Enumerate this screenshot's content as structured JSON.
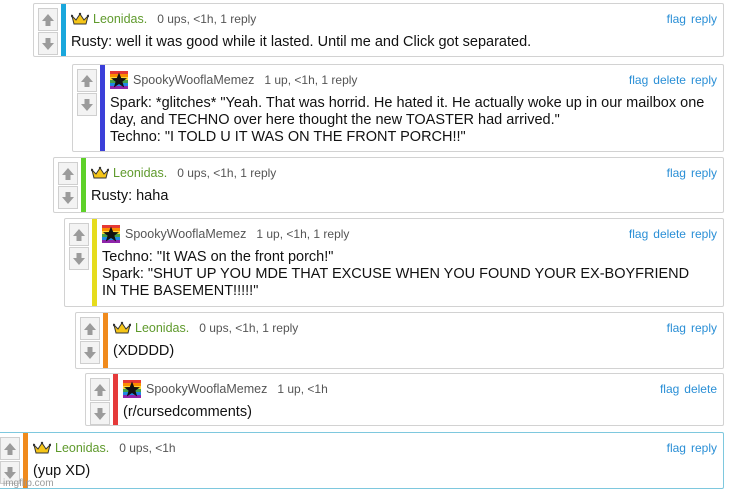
{
  "comments": [
    {
      "user": "Leonidas.",
      "badge": "crown",
      "meta": "0 ups, <1h, 1 reply",
      "actions": [
        "flag",
        "reply"
      ],
      "text": "Rusty: well it was good while it lasted. Until me and Click got separated."
    },
    {
      "user": "SpookyWooflaMemez",
      "badge": "avatar",
      "meta": "1 up, <1h, 1 reply",
      "actions": [
        "flag",
        "delete",
        "reply"
      ],
      "text": "Spark: *glitches* \"Yeah. That was horrid. He hated it. He actually woke up in our mailbox one\nday, and TECHNO over here thought the new TOASTER had arrived.\"\nTechno: \"I TOLD U IT WAS ON THE FRONT PORCH!!\""
    },
    {
      "user": "Leonidas.",
      "badge": "crown",
      "meta": "0 ups, <1h, 1 reply",
      "actions": [
        "flag",
        "reply"
      ],
      "text": "Rusty: haha"
    },
    {
      "user": "SpookyWooflaMemez",
      "badge": "avatar",
      "meta": "1 up, <1h, 1 reply",
      "actions": [
        "flag",
        "delete",
        "reply"
      ],
      "text": "Techno: \"It WAS on the front porch!\"\nSpark: \"SHUT UP YOU MDE THAT EXCUSE WHEN YOU FOUND YOUR EX-BOYFRIEND\nIN THE BASEMENT!!!!!\""
    },
    {
      "user": "Leonidas.",
      "badge": "crown",
      "meta": "0 ups, <1h, 1 reply",
      "actions": [
        "flag",
        "reply"
      ],
      "text": "(XDDDD)"
    },
    {
      "user": "SpookyWooflaMemez",
      "badge": "avatar",
      "meta": "1 up, <1h",
      "actions": [
        "flag",
        "delete"
      ],
      "text": "(r/cursedcomments)"
    },
    {
      "user": "Leonidas.",
      "badge": "crown",
      "meta": "0 ups, <1h",
      "actions": [
        "flag",
        "reply"
      ],
      "text": "(yup XD)"
    }
  ],
  "colors": {
    "stripes": [
      "#1aa7dc",
      "#3b3fd9",
      "#5ed129",
      "#e6dc1c",
      "#f08a1c",
      "#e53a3a",
      "#f08a1c"
    ],
    "link": "#2a8fd6",
    "username_gold": "#5f9a2c"
  },
  "icons": {
    "upvote": "up-arrow-icon",
    "downvote": "down-arrow-icon",
    "crown": "crown-icon",
    "avatar": "rainbow-star-avatar-icon"
  },
  "watermark": "imgflip.com"
}
